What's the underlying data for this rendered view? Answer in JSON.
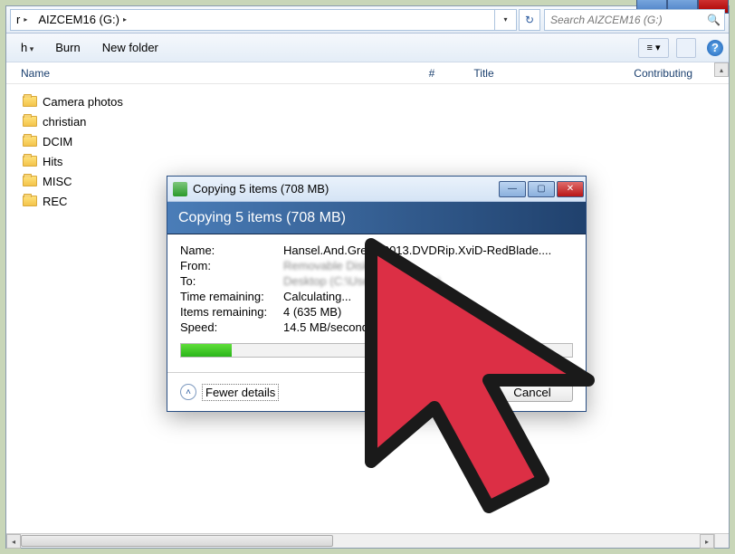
{
  "breadcrumb": {
    "prefix": "r",
    "drive": "AIZCEM16 (G:)"
  },
  "search": {
    "placeholder": "Search AIZCEM16 (G:)"
  },
  "toolbar": {
    "organize_suffix": "h",
    "burn": "Burn",
    "new_folder": "New folder"
  },
  "columns": {
    "name": "Name",
    "num": "#",
    "title": "Title",
    "contrib": "Contributing"
  },
  "folders": [
    {
      "label": "Camera photos"
    },
    {
      "label": "christian"
    },
    {
      "label": "DCIM"
    },
    {
      "label": "Hits"
    },
    {
      "label": "MISC"
    },
    {
      "label": "REC"
    }
  ],
  "dialog": {
    "window_title": "Copying 5 items (708 MB)",
    "heading": "Copying 5 items (708 MB)",
    "rows": {
      "name_label": "Name:",
      "name_value": "Hansel.And.Gretel.2013.DVDRip.XviD-RedBlade....",
      "from_label": "From:",
      "from_value": "Removable Disk (I:)",
      "to_label": "To:",
      "to_value": "Desktop (C:\\Users\\Mike201...)",
      "time_label": "Time remaining:",
      "time_value": "Calculating...",
      "items_label": "Items remaining:",
      "items_value": "4 (635 MB)",
      "speed_label": "Speed:",
      "speed_value": "14.5 MB/second"
    },
    "fewer": "Fewer details",
    "cancel": "Cancel"
  },
  "help_glyph": "?"
}
